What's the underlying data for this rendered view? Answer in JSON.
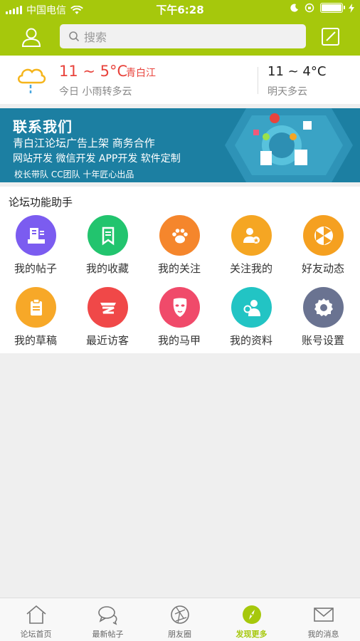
{
  "status_bar": {
    "carrier": "中国电信",
    "time": "下午6:28"
  },
  "header": {
    "search_placeholder": "搜索"
  },
  "weather": {
    "today_temp": "11 ~ 5°C",
    "city": "青白江",
    "today_desc": "今日 小雨转多云",
    "tomorrow_temp": "11 ~ 4°C",
    "tomorrow_desc": "明天多云"
  },
  "banner": {
    "title": "联系我们",
    "line1": "青白江论坛广告上架 商务合作",
    "line2": "网站开发 微信开发 APP开发 软件定制",
    "line3": "校长带队 CC团队 十年匠心出品"
  },
  "assistant": {
    "title": "论坛功能助手",
    "items": [
      {
        "label": "我的帖子",
        "icon": "my-posts-icon",
        "color": "#7b5cf0"
      },
      {
        "label": "我的收藏",
        "icon": "bookmark-icon",
        "color": "#22c46e"
      },
      {
        "label": "我的关注",
        "icon": "paw-icon",
        "color": "#f5862c"
      },
      {
        "label": "关注我的",
        "icon": "followers-icon",
        "color": "#f5a623"
      },
      {
        "label": "好友动态",
        "icon": "aperture-icon",
        "color": "#f5a020"
      },
      {
        "label": "我的草稿",
        "icon": "clipboard-icon",
        "color": "#f7a828"
      },
      {
        "label": "最近访客",
        "icon": "visitors-icon",
        "color": "#f04848"
      },
      {
        "label": "我的马甲",
        "icon": "mask-icon",
        "color": "#f04a6a"
      },
      {
        "label": "我的资料",
        "icon": "profile-search-icon",
        "color": "#22c4c4"
      },
      {
        "label": "账号设置",
        "icon": "gear-icon",
        "color": "#6a7391"
      }
    ]
  },
  "tabbar": {
    "items": [
      {
        "label": "论坛首页",
        "icon": "home-icon"
      },
      {
        "label": "最新帖子",
        "icon": "chat-bubbles-icon"
      },
      {
        "label": "朋友圈",
        "icon": "camera-aperture-icon"
      },
      {
        "label": "发现更多",
        "icon": "compass-icon",
        "active": true
      },
      {
        "label": "我的消息",
        "icon": "mail-icon"
      }
    ]
  },
  "colors": {
    "brand": "#a6c80c",
    "banner_bg": "#1c7fa2",
    "weather_red": "#e8433c"
  }
}
